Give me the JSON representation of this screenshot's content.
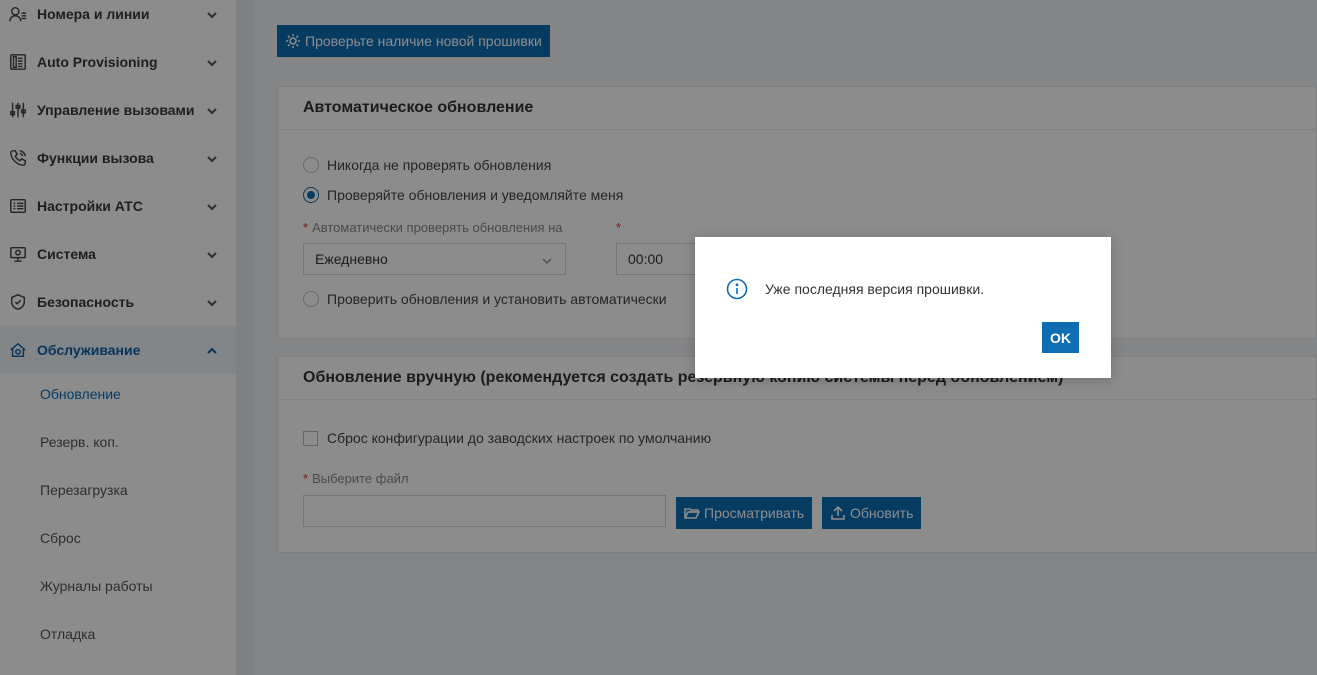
{
  "sidebar": {
    "items": [
      {
        "label": "Номера и линии",
        "icon": "extension-icon"
      },
      {
        "label": "Auto Provisioning",
        "icon": "phone-device-icon"
      },
      {
        "label": "Управление вызовами",
        "icon": "sliders-icon"
      },
      {
        "label": "Функции вызова",
        "icon": "phone-call-icon"
      },
      {
        "label": "Настройки АТС",
        "icon": "list-settings-icon"
      },
      {
        "label": "Система",
        "icon": "system-monitor-icon"
      },
      {
        "label": "Безопасность",
        "icon": "shield-icon"
      },
      {
        "label": "Обслуживание",
        "icon": "maintenance-icon"
      }
    ],
    "subitems": [
      {
        "label": "Обновление"
      },
      {
        "label": "Резерв. коп."
      },
      {
        "label": "Перезагрузка"
      },
      {
        "label": "Сброс"
      },
      {
        "label": "Журналы работы"
      },
      {
        "label": "Отладка"
      }
    ]
  },
  "main": {
    "check_button_label": "Проверьте наличие новой прошивки",
    "auto_update": {
      "title": "Автоматическое обновление",
      "option_never": "Никогда не проверять обновления",
      "option_notify": "Проверяйте обновления и уведомляйте меня",
      "frequency_label": "Автоматически проверять обновления на",
      "frequency_value": "Ежедневно",
      "time_value": "00:00",
      "option_auto_install": "Проверить обновления и установить автоматически",
      "required_mark": "*"
    },
    "manual_update": {
      "title": "Обновление вручную (рекомендуется создать резервную копию системы перед обновлением)",
      "reset_label": "Сброс конфигурации до заводских настроек по умолчанию",
      "file_label": "Выберите файл",
      "browse_label": "Просматривать",
      "upload_label": "Обновить",
      "required_mark": "*"
    }
  },
  "dialog": {
    "message": "Уже последняя версия прошивки.",
    "ok_label": "OK"
  },
  "colors": {
    "accent": "#0e6db3",
    "required": "#e02d2d"
  }
}
